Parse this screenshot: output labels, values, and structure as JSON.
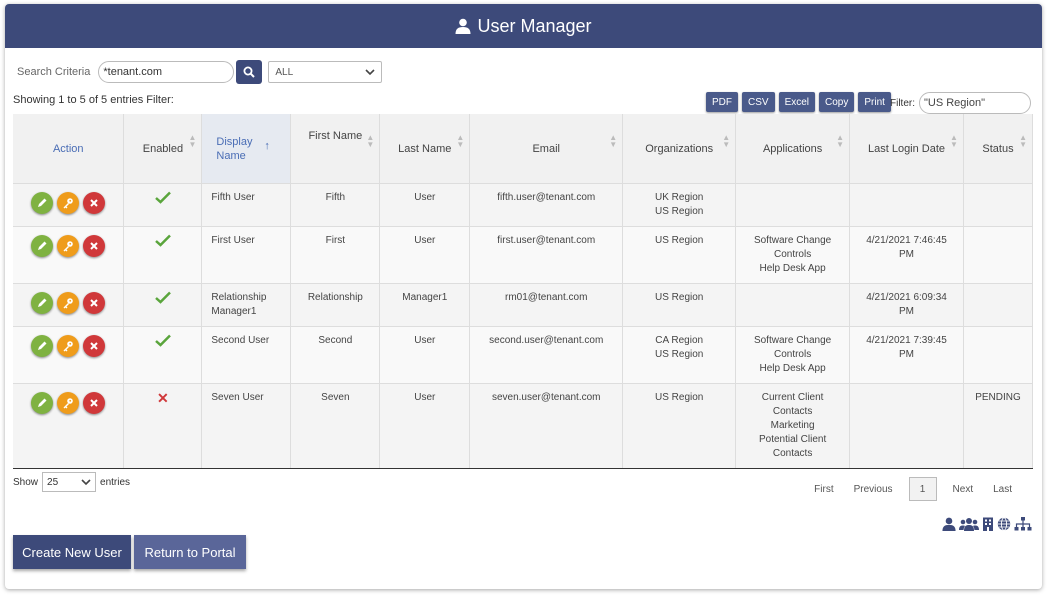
{
  "header": {
    "title": "User Manager"
  },
  "search": {
    "label": "Search Criteria",
    "value": "*tenant.com",
    "select_value": "ALL"
  },
  "summary": {
    "showing": "Showing 1 to 5 of 5 entries Filter:"
  },
  "export": {
    "pdf": "PDF",
    "csv": "CSV",
    "excel": "Excel",
    "copy": "Copy",
    "print": "Print"
  },
  "filter": {
    "label": "Filter:",
    "value": "\"US Region\""
  },
  "table": {
    "columns": [
      "Action",
      "Enabled",
      "Display Name",
      "First Name",
      "Last Name",
      "Email",
      "Organizations",
      "Applications",
      "Last Login Date",
      "Status"
    ],
    "rows": [
      {
        "enabled": true,
        "display_name": "Fifth User",
        "first_name": "Fifth",
        "last_name": "User",
        "email": "fifth.user@tenant.com",
        "organizations": [
          "UK Region",
          "US Region"
        ],
        "applications": [],
        "last_login": [
          "",
          ""
        ],
        "status": ""
      },
      {
        "enabled": true,
        "display_name": "First User",
        "first_name": "First",
        "last_name": "User",
        "email": "first.user@tenant.com",
        "organizations": [
          "US Region"
        ],
        "applications": [
          "Software Change",
          "Controls",
          "Help Desk App"
        ],
        "last_login": [
          "4/21/2021 7:46:45",
          "PM"
        ],
        "status": ""
      },
      {
        "enabled": true,
        "display_name": "Relationship Manager1",
        "first_name": "Relationship",
        "last_name": "Manager1",
        "email": "rm01@tenant.com",
        "organizations": [
          "US Region"
        ],
        "applications": [],
        "last_login": [
          "4/21/2021 6:09:34",
          "PM"
        ],
        "status": ""
      },
      {
        "enabled": true,
        "display_name": "Second User",
        "first_name": "Second",
        "last_name": "User",
        "email": "second.user@tenant.com",
        "organizations": [
          "CA Region",
          "US Region"
        ],
        "applications": [
          "Software Change",
          "Controls",
          "Help Desk App"
        ],
        "last_login": [
          "4/21/2021 7:39:45",
          "PM"
        ],
        "status": ""
      },
      {
        "enabled": false,
        "display_name": "Seven User",
        "first_name": "Seven",
        "last_name": "User",
        "email": "seven.user@tenant.com",
        "organizations": [
          "US Region"
        ],
        "applications": [
          "Current Client",
          "Contacts",
          "Marketing",
          "Potential Client",
          "Contacts"
        ],
        "last_login": [
          "",
          ""
        ],
        "status": "PENDING"
      }
    ]
  },
  "footer": {
    "show_label": "Show",
    "page_size": "25",
    "entries_label": "entries",
    "pager": {
      "first": "First",
      "previous": "Previous",
      "current": "1",
      "next": "Next",
      "last": "Last"
    },
    "create_button": "Create New User",
    "return_button": "Return to Portal"
  },
  "colors": {
    "header": "#3d4a7a",
    "button": "#3d4a7a",
    "button_alt": "#5a6699",
    "edit": "#7fb241",
    "key": "#ef9c1b",
    "delete": "#d0383a"
  }
}
